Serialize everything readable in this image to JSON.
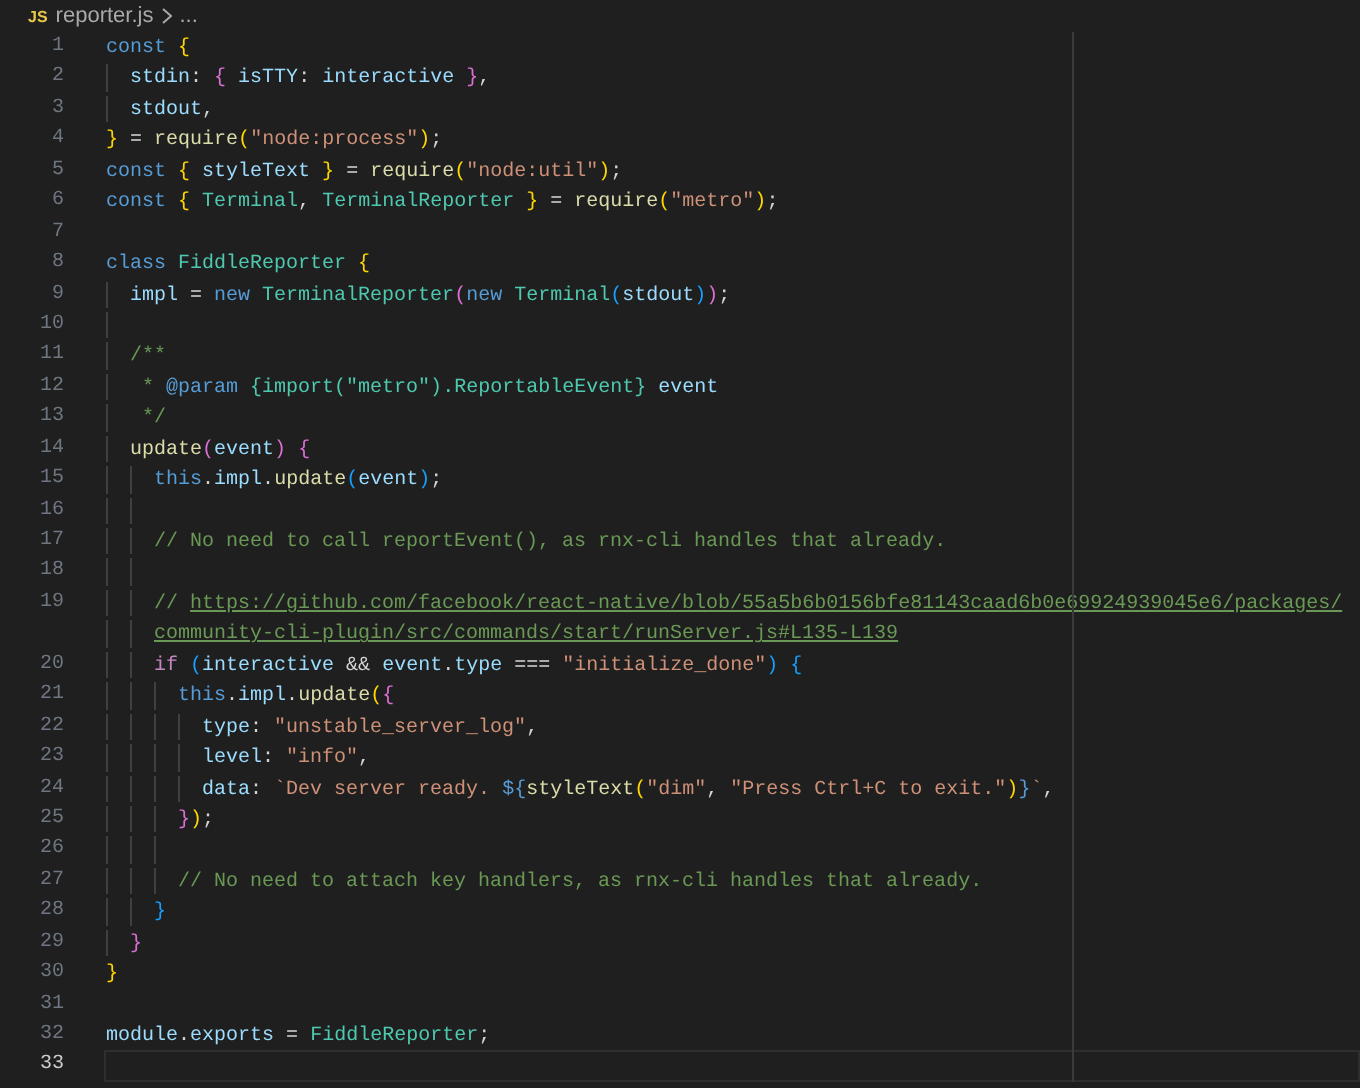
{
  "breadcrumb": {
    "file_icon": "JS",
    "file": "reporter.js",
    "more": "..."
  },
  "editor": {
    "lines": [
      {
        "number": "1",
        "current": false,
        "tokens": [
          {
            "text": "const ",
            "kind": "k"
          },
          {
            "text": "{",
            "kind": "b1"
          }
        ]
      },
      {
        "number": "2",
        "current": false,
        "tokens": [
          {
            "text": "  stdin",
            "kind": "v"
          },
          {
            "text": ": ",
            "kind": "p"
          },
          {
            "text": "{ ",
            "kind": "b2"
          },
          {
            "text": "isTTY",
            "kind": "v"
          },
          {
            "text": ": ",
            "kind": "p"
          },
          {
            "text": "interactive ",
            "kind": "v"
          },
          {
            "text": "}",
            "kind": "b2"
          },
          {
            "text": ",",
            "kind": "p"
          }
        ]
      },
      {
        "number": "3",
        "current": false,
        "tokens": [
          {
            "text": "  stdout",
            "kind": "v"
          },
          {
            "text": ",",
            "kind": "p"
          }
        ]
      },
      {
        "number": "4",
        "current": false,
        "tokens": [
          {
            "text": "}",
            "kind": "b1"
          },
          {
            "text": " = ",
            "kind": "p"
          },
          {
            "text": "require",
            "kind": "f"
          },
          {
            "text": "(",
            "kind": "b1"
          },
          {
            "text": "\"node:process\"",
            "kind": "s"
          },
          {
            "text": ")",
            "kind": "b1"
          },
          {
            "text": ";",
            "kind": "p"
          }
        ]
      },
      {
        "number": "5",
        "current": false,
        "tokens": [
          {
            "text": "const ",
            "kind": "k"
          },
          {
            "text": "{ ",
            "kind": "b1"
          },
          {
            "text": "styleText ",
            "kind": "v"
          },
          {
            "text": "}",
            "kind": "b1"
          },
          {
            "text": " = ",
            "kind": "p"
          },
          {
            "text": "require",
            "kind": "f"
          },
          {
            "text": "(",
            "kind": "b1"
          },
          {
            "text": "\"node:util\"",
            "kind": "s"
          },
          {
            "text": ")",
            "kind": "b1"
          },
          {
            "text": ";",
            "kind": "p"
          }
        ]
      },
      {
        "number": "6",
        "current": false,
        "tokens": [
          {
            "text": "const ",
            "kind": "k"
          },
          {
            "text": "{ ",
            "kind": "b1"
          },
          {
            "text": "Terminal",
            "kind": "t"
          },
          {
            "text": ", ",
            "kind": "p"
          },
          {
            "text": "TerminalReporter ",
            "kind": "t"
          },
          {
            "text": "}",
            "kind": "b1"
          },
          {
            "text": " = ",
            "kind": "p"
          },
          {
            "text": "require",
            "kind": "f"
          },
          {
            "text": "(",
            "kind": "b1"
          },
          {
            "text": "\"metro\"",
            "kind": "s"
          },
          {
            "text": ")",
            "kind": "b1"
          },
          {
            "text": ";",
            "kind": "p"
          }
        ]
      },
      {
        "number": "7",
        "current": false
      },
      {
        "number": "8",
        "current": false,
        "tokens": [
          {
            "text": "class ",
            "kind": "k"
          },
          {
            "text": "FiddleReporter ",
            "kind": "t"
          },
          {
            "text": "{",
            "kind": "b1"
          }
        ]
      },
      {
        "number": "9",
        "current": false,
        "tokens": [
          {
            "text": "  impl",
            "kind": "v"
          },
          {
            "text": " = ",
            "kind": "p"
          },
          {
            "text": "new ",
            "kind": "k"
          },
          {
            "text": "TerminalReporter",
            "kind": "t"
          },
          {
            "text": "(",
            "kind": "b2"
          },
          {
            "text": "new ",
            "kind": "k"
          },
          {
            "text": "Terminal",
            "kind": "t"
          },
          {
            "text": "(",
            "kind": "b3"
          },
          {
            "text": "stdout",
            "kind": "v"
          },
          {
            "text": ")",
            "kind": "b3"
          },
          {
            "text": ")",
            "kind": "b2"
          },
          {
            "text": ";",
            "kind": "p"
          }
        ]
      },
      {
        "number": "10",
        "current": false
      },
      {
        "number": "11",
        "current": false,
        "tokens": [
          {
            "text": "  /**",
            "kind": "m"
          }
        ]
      },
      {
        "number": "12",
        "current": false,
        "tokens": [
          {
            "text": "   * ",
            "kind": "m"
          },
          {
            "text": "@param ",
            "kind": "k"
          },
          {
            "text": "{import(\"metro\").ReportableEvent} ",
            "kind": "t"
          },
          {
            "text": "event",
            "kind": "v"
          }
        ]
      },
      {
        "number": "13",
        "current": false,
        "tokens": [
          {
            "text": "   */",
            "kind": "m"
          }
        ]
      },
      {
        "number": "14",
        "current": false,
        "tokens": [
          {
            "text": "  update",
            "kind": "f"
          },
          {
            "text": "(",
            "kind": "b2"
          },
          {
            "text": "event",
            "kind": "v"
          },
          {
            "text": ")",
            "kind": "b2"
          },
          {
            "text": " {",
            "kind": "b2"
          }
        ]
      },
      {
        "number": "15",
        "current": false,
        "tokens": [
          {
            "text": "    this",
            "kind": "k"
          },
          {
            "text": ".",
            "kind": "p"
          },
          {
            "text": "impl",
            "kind": "v"
          },
          {
            "text": ".",
            "kind": "p"
          },
          {
            "text": "update",
            "kind": "f"
          },
          {
            "text": "(",
            "kind": "b3"
          },
          {
            "text": "event",
            "kind": "v"
          },
          {
            "text": ")",
            "kind": "b3"
          },
          {
            "text": ";",
            "kind": "p"
          }
        ]
      },
      {
        "number": "16",
        "current": false
      },
      {
        "number": "17",
        "current": false,
        "tokens": [
          {
            "text": "    // No need to call reportEvent(), as rnx-cli handles that already.",
            "kind": "m"
          }
        ]
      },
      {
        "number": "18",
        "current": false
      },
      {
        "number": "19",
        "current": false,
        "tokens": [
          {
            "text": "    // ",
            "kind": "m"
          },
          {
            "text": "https://github.com/facebook/react-native/blob/55a5b6b0156bfe81143caad6b0e69924939045e6/packages/",
            "kind": "u"
          }
        ],
        "wrapped": [
          {
            "text": "community-cli-plugin/src/commands/start/runServer.js#L135-L139",
            "kind": "u"
          }
        ]
      },
      {
        "number": "20",
        "current": false,
        "tokens": [
          {
            "text": "    if ",
            "kind": "c"
          },
          {
            "text": "(",
            "kind": "b3"
          },
          {
            "text": "interactive",
            "kind": "v"
          },
          {
            "text": " && ",
            "kind": "p"
          },
          {
            "text": "event",
            "kind": "v"
          },
          {
            "text": ".",
            "kind": "p"
          },
          {
            "text": "type",
            "kind": "v"
          },
          {
            "text": " === ",
            "kind": "p"
          },
          {
            "text": "\"initialize_done\"",
            "kind": "s"
          },
          {
            "text": ")",
            "kind": "b3"
          },
          {
            "text": " {",
            "kind": "b3"
          }
        ]
      },
      {
        "number": "21",
        "current": false,
        "tokens": [
          {
            "text": "      this",
            "kind": "k"
          },
          {
            "text": ".",
            "kind": "p"
          },
          {
            "text": "impl",
            "kind": "v"
          },
          {
            "text": ".",
            "kind": "p"
          },
          {
            "text": "update",
            "kind": "f"
          },
          {
            "text": "(",
            "kind": "b1"
          },
          {
            "text": "{",
            "kind": "b2"
          }
        ]
      },
      {
        "number": "22",
        "current": false,
        "tokens": [
          {
            "text": "        type",
            "kind": "v"
          },
          {
            "text": ": ",
            "kind": "p"
          },
          {
            "text": "\"unstable_server_log\"",
            "kind": "s"
          },
          {
            "text": ",",
            "kind": "p"
          }
        ]
      },
      {
        "number": "23",
        "current": false,
        "tokens": [
          {
            "text": "        level",
            "kind": "v"
          },
          {
            "text": ": ",
            "kind": "p"
          },
          {
            "text": "\"info\"",
            "kind": "s"
          },
          {
            "text": ",",
            "kind": "p"
          }
        ]
      },
      {
        "number": "24",
        "current": false,
        "tokens": [
          {
            "text": "        data",
            "kind": "v"
          },
          {
            "text": ": ",
            "kind": "p"
          },
          {
            "text": "`Dev server ready. ",
            "kind": "s"
          },
          {
            "text": "${",
            "kind": "k"
          },
          {
            "text": "styleText",
            "kind": "f"
          },
          {
            "text": "(",
            "kind": "b1"
          },
          {
            "text": "\"dim\"",
            "kind": "s"
          },
          {
            "text": ", ",
            "kind": "p"
          },
          {
            "text": "\"Press Ctrl+C to exit.\"",
            "kind": "s"
          },
          {
            "text": ")",
            "kind": "b1"
          },
          {
            "text": "}",
            "kind": "k"
          },
          {
            "text": "`",
            "kind": "s"
          },
          {
            "text": ",",
            "kind": "p"
          }
        ]
      },
      {
        "number": "25",
        "current": false,
        "tokens": [
          {
            "text": "      }",
            "kind": "b2"
          },
          {
            "text": ")",
            "kind": "b1"
          },
          {
            "text": ";",
            "kind": "p"
          }
        ]
      },
      {
        "number": "26",
        "current": false
      },
      {
        "number": "27",
        "current": false,
        "tokens": [
          {
            "text": "      // No need to attach key handlers, as rnx-cli handles that already.",
            "kind": "m"
          }
        ]
      },
      {
        "number": "28",
        "current": false,
        "tokens": [
          {
            "text": "    }",
            "kind": "b3"
          }
        ]
      },
      {
        "number": "29",
        "current": false,
        "tokens": [
          {
            "text": "  }",
            "kind": "b2"
          }
        ]
      },
      {
        "number": "30",
        "current": false,
        "tokens": [
          {
            "text": "}",
            "kind": "b1"
          }
        ]
      },
      {
        "number": "31",
        "current": false
      },
      {
        "number": "32",
        "current": false,
        "tokens": [
          {
            "text": "module",
            "kind": "v"
          },
          {
            "text": ".",
            "kind": "p"
          },
          {
            "text": "exports",
            "kind": "v"
          },
          {
            "text": " = ",
            "kind": "p"
          },
          {
            "text": "FiddleReporter",
            "kind": "t"
          },
          {
            "text": ";",
            "kind": "p"
          }
        ]
      },
      {
        "number": "33",
        "current": true
      }
    ]
  }
}
